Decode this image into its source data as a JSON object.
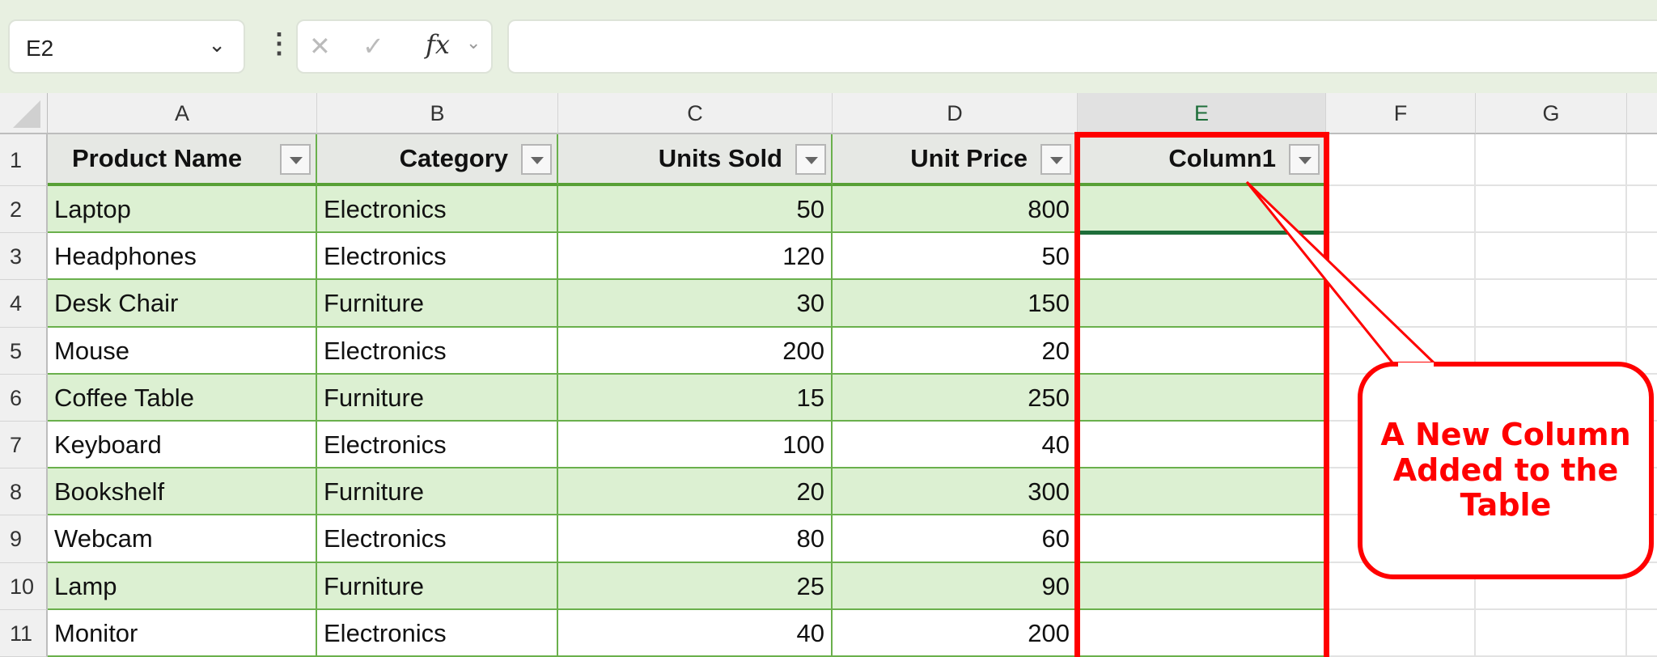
{
  "name_box": {
    "value": "E2"
  },
  "formula_bar": {
    "value": ""
  },
  "column_headers": [
    "A",
    "B",
    "C",
    "D",
    "E",
    "F",
    "G"
  ],
  "row_headers": [
    "1",
    "2",
    "3",
    "4",
    "5",
    "6",
    "7",
    "8",
    "9",
    "10",
    "11"
  ],
  "table": {
    "headers": [
      "Product Name",
      "Category",
      "Units Sold",
      "Unit Price",
      "Column1"
    ],
    "rows": [
      [
        "Laptop",
        "Electronics",
        "50",
        "800",
        ""
      ],
      [
        "Headphones",
        "Electronics",
        "120",
        "50",
        ""
      ],
      [
        "Desk Chair",
        "Furniture",
        "30",
        "150",
        ""
      ],
      [
        "Mouse",
        "Electronics",
        "200",
        "20",
        ""
      ],
      [
        "Coffee Table",
        "Furniture",
        "15",
        "250",
        ""
      ],
      [
        "Keyboard",
        "Electronics",
        "100",
        "40",
        ""
      ],
      [
        "Bookshelf",
        "Furniture",
        "20",
        "300",
        ""
      ],
      [
        "Webcam",
        "Electronics",
        "80",
        "60",
        ""
      ],
      [
        "Lamp",
        "Furniture",
        "25",
        "90",
        ""
      ],
      [
        "Monitor",
        "Electronics",
        "40",
        "200",
        ""
      ]
    ]
  },
  "callout": {
    "text": "A New Column Added to the Table"
  },
  "colors": {
    "band": "#dcf0d2",
    "border": "#6ab04c",
    "annotation": "#ff0000"
  }
}
